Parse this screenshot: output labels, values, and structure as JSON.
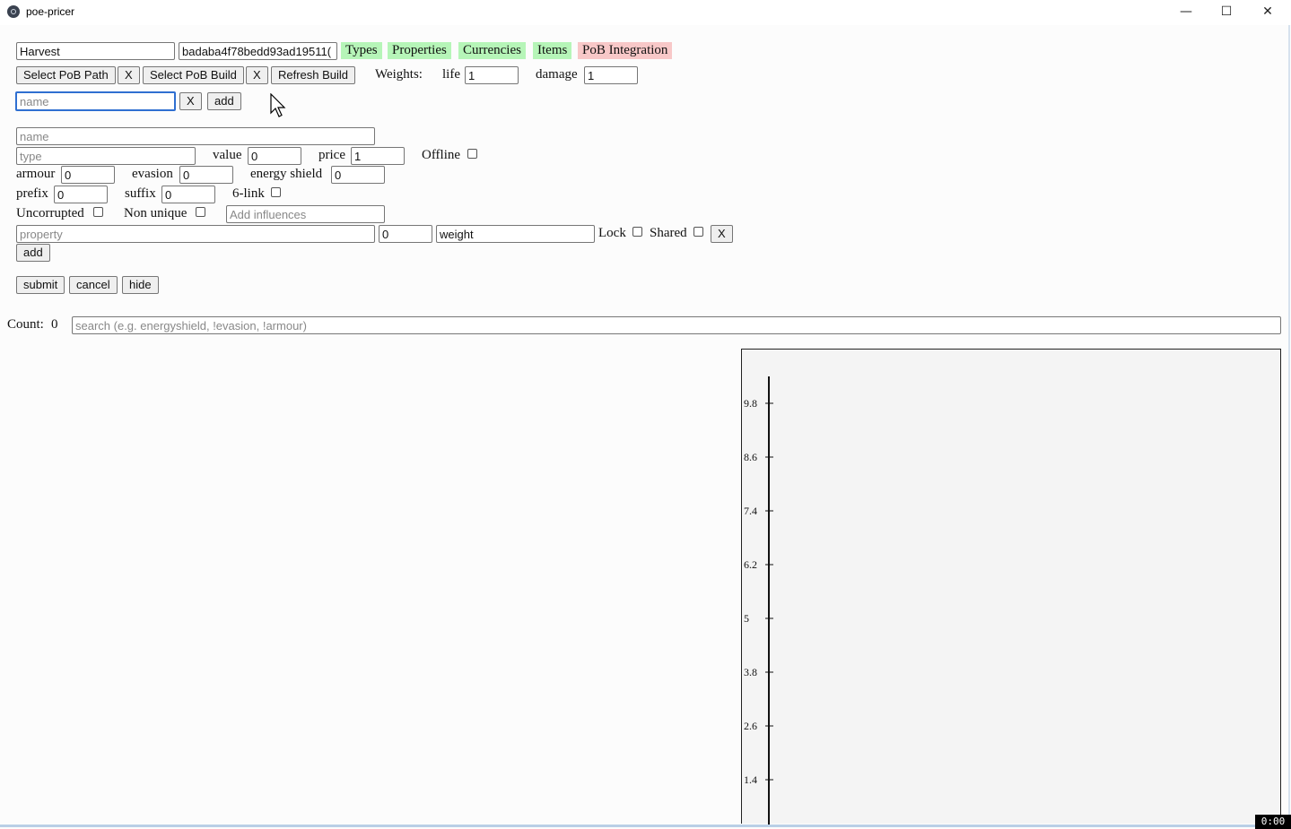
{
  "window": {
    "title": "poe-pricer",
    "minimize_glyph": "—",
    "maximize_glyph": "☐",
    "close_glyph": "✕"
  },
  "top": {
    "league_value": "Harvest",
    "session_value": "badaba4f78bedd93ad19511(",
    "tabs": [
      {
        "label": "Types",
        "color": "#b6f5b8"
      },
      {
        "label": "Properties",
        "color": "#b6f5b8"
      },
      {
        "label": "Currencies",
        "color": "#b6f5b8"
      },
      {
        "label": "Items",
        "color": "#b6f5b8"
      },
      {
        "label": "PoB Integration",
        "color": "#f8c8c8"
      }
    ]
  },
  "pob": {
    "select_path_label": "Select PoB Path",
    "clear_label": "X",
    "select_build_label": "Select PoB Build",
    "refresh_label": "Refresh Build",
    "weights_label": "Weights:",
    "life_label": "life",
    "life_value": "1",
    "damage_label": "damage",
    "damage_value": "1"
  },
  "quick_add": {
    "name_placeholder": "name",
    "clear_label": "X",
    "add_label": "add"
  },
  "form": {
    "name_placeholder": "name",
    "type_placeholder": "type",
    "value_label": "value",
    "value_value": "0",
    "price_label": "price",
    "price_value": "1",
    "offline_label": "Offline",
    "armour_label": "armour",
    "armour_value": "0",
    "evasion_label": "evasion",
    "evasion_value": "0",
    "energy_shield_label": "energy shield",
    "energy_shield_value": "0",
    "prefix_label": "prefix",
    "prefix_value": "0",
    "suffix_label": "suffix",
    "suffix_value": "0",
    "six_link_label": "6-link",
    "uncorrupted_label": "Uncorrupted",
    "non_unique_label": "Non unique",
    "influences_placeholder": "Add influences",
    "property_placeholder": "property",
    "property_value": "0",
    "weight_value": "weight",
    "lock_label": "Lock",
    "shared_label": "Shared",
    "remove_label": "X",
    "add_label": "add",
    "submit_label": "submit",
    "cancel_label": "cancel",
    "hide_label": "hide"
  },
  "results": {
    "count_label": "Count:",
    "count_value": "0",
    "search_placeholder": "search (e.g. energyshield, !evasion, !armour)"
  },
  "chart_data": {
    "type": "scatter",
    "y_ticks": [
      "9.8",
      "8.6",
      "7.4",
      "6.2",
      "5",
      "3.8",
      "2.6",
      "1.4"
    ],
    "series": []
  },
  "status": {
    "clock": "0:00"
  }
}
